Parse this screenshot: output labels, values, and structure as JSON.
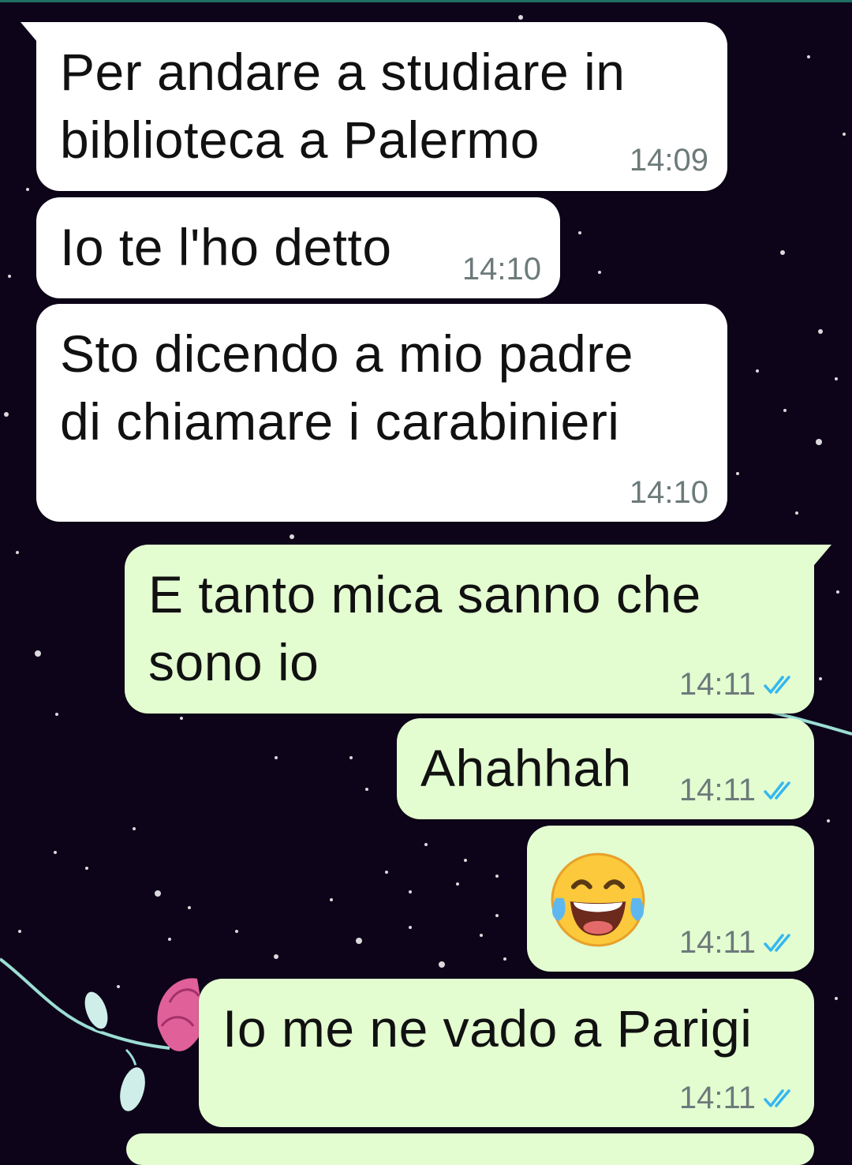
{
  "messages": [
    {
      "direction": "incoming",
      "text_lines": [
        "Per andare a studiare in",
        "biblioteca a Palermo"
      ],
      "time": "14:09"
    },
    {
      "direction": "incoming",
      "text_lines": [
        "Io te l'ho detto"
      ],
      "time": "14:10"
    },
    {
      "direction": "incoming",
      "text_lines": [
        "Sto dicendo a mio padre",
        "di chiamare i carabinieri"
      ],
      "time": "14:10"
    },
    {
      "direction": "outgoing",
      "text_lines": [
        "E tanto mica sanno che",
        "sono io"
      ],
      "time": "14:11",
      "status": "read"
    },
    {
      "direction": "outgoing",
      "text_lines": [
        "Ahahhah"
      ],
      "time": "14:11",
      "status": "read"
    },
    {
      "direction": "outgoing",
      "emoji": "face-with-tears-of-joy",
      "time": "14:11",
      "status": "read"
    },
    {
      "direction": "outgoing",
      "text_lines": [
        "Io me ne vado a Parigi"
      ],
      "time": "14:11",
      "status": "read"
    }
  ],
  "icons": {
    "read_receipt": "double-check-icon",
    "emoji": "face-with-tears-of-joy-icon"
  },
  "colors": {
    "incoming_bubble": "#ffffff",
    "outgoing_bubble": "#e3fdd1",
    "background": "#0d0419",
    "read_tick": "#34b7f1",
    "timestamp": "#6d7a7a",
    "rose": "#e0609a"
  }
}
